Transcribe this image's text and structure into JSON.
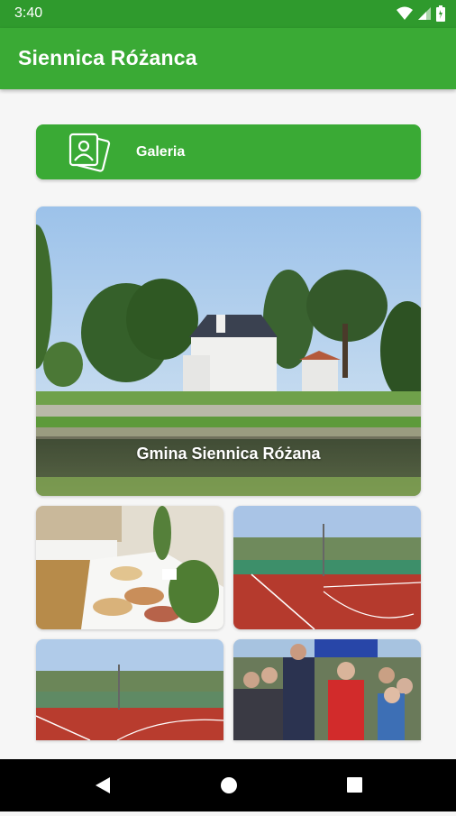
{
  "status_bar": {
    "time": "3:40",
    "icons": [
      "wifi-icon",
      "signal-icon",
      "battery-icon"
    ]
  },
  "app_bar": {
    "title": "Siennica Różanca"
  },
  "gallery_button": {
    "label": "Galeria",
    "icon": "photo-gallery-icon"
  },
  "hero": {
    "caption": "Gmina Siennica Różana"
  },
  "tiles": [
    {
      "name": "food-table-photo"
    },
    {
      "name": "sports-court-photo"
    },
    {
      "name": "sports-court-photo-2"
    },
    {
      "name": "ceremony-crowd-photo"
    }
  ],
  "nav_bar": {
    "buttons": [
      "back-icon",
      "home-icon",
      "recent-apps-icon"
    ]
  },
  "colors": {
    "primary": "#3aaa35",
    "primary_dark": "#2f9a2d",
    "background": "#f6f6f6"
  }
}
